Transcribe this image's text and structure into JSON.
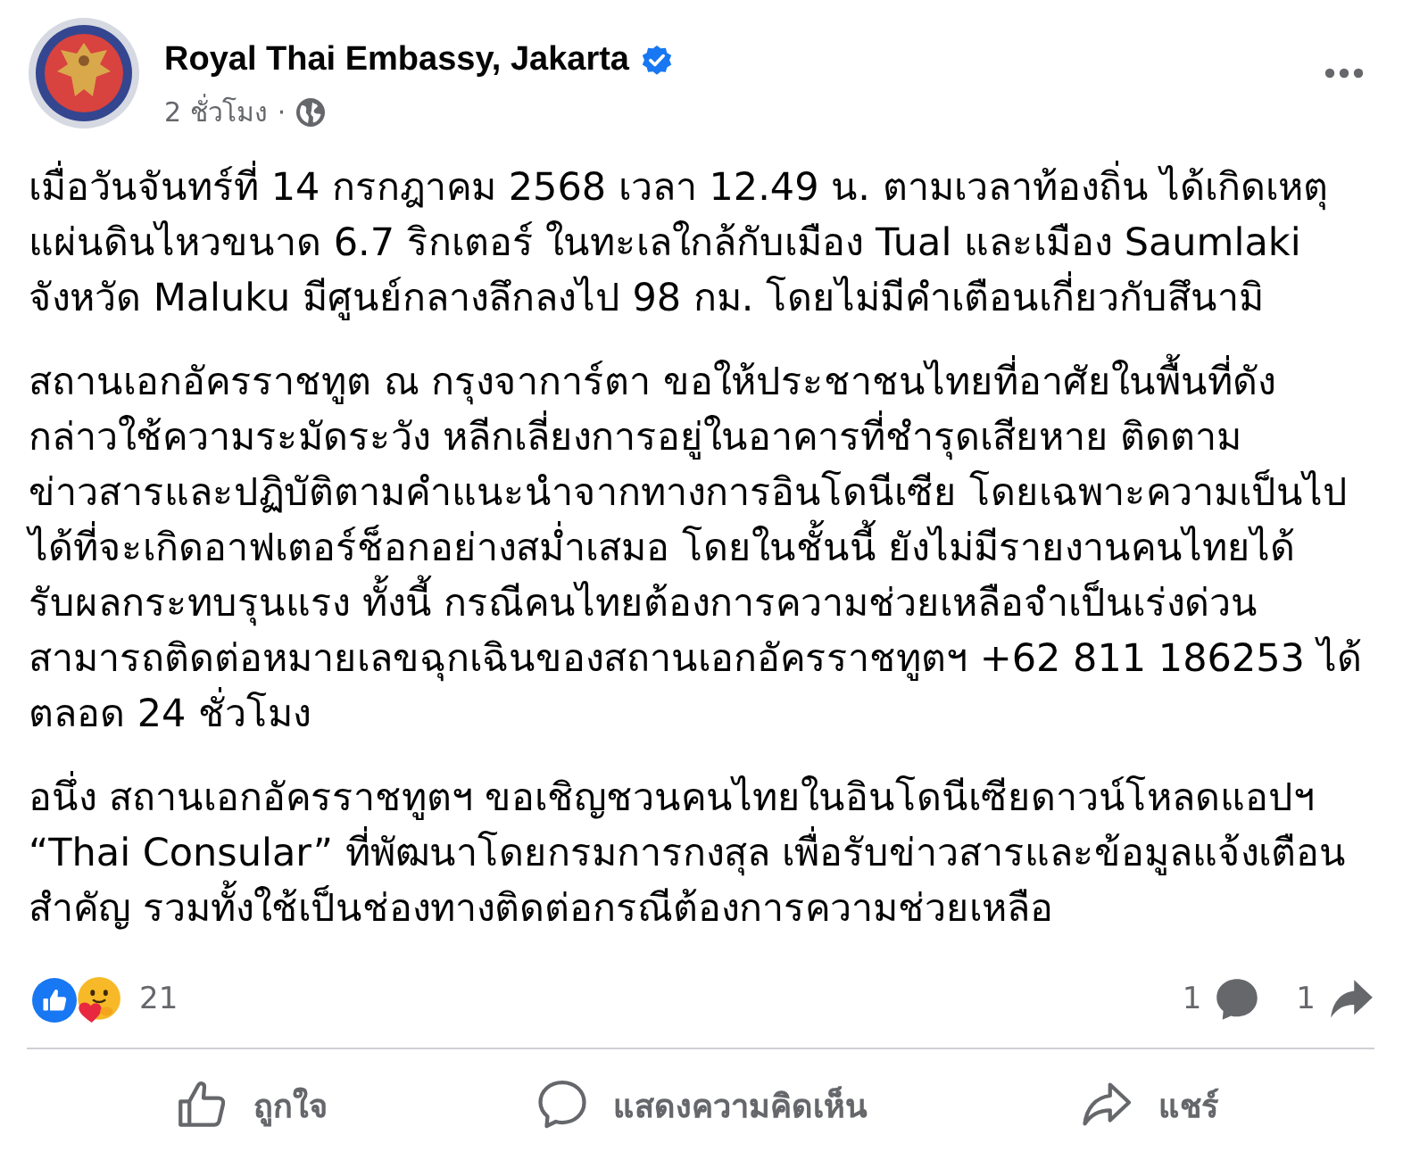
{
  "post": {
    "author": "Royal Thai Embassy, Jakarta",
    "verified": true,
    "time": "2 ชั่วโมง",
    "separator": "·"
  },
  "paragraphs": [
    {
      "lines": [
        "เมื่อวันจันทร์ที่ 14 กรกฎาคม 2568 เวลา 12.49 น. ตามเวลาท้องถิ่น ได้เกิดเหตุ",
        "แผ่นดินไหวขนาด 6.7 ริกเตอร์ ในทะเลใกล้กับเมือง Tual และเมือง Saumlaki",
        "จังหวัด Maluku มีศูนย์กลางลึกลงไป 98 กม. โดยไม่มีคำเตือนเกี่ยวกับสึนามิ"
      ]
    },
    {
      "lines": [
        "สถานเอกอัครราชทูต ณ กรุงจาการ์ตา ขอให้ประชาชนไทยที่อาศัยในพื้นที่ดัง",
        "กล่าวใช้ความระมัดระวัง หลีกเลี่ยงการอยู่ในอาคารที่ชำรุดเสียหาย ติดตาม",
        "ข่าวสารและปฏิบัติตามคำแนะนำจากทางการอินโดนีเซีย โดยเฉพาะความเป็นไป",
        "ได้ที่จะเกิดอาฟเตอร์ช็อกอย่างสม่ำเสมอ โดยในชั้นนี้ ยังไม่มีรายงานคนไทยได้",
        "รับผลกระทบรุนแรง ทั้งนี้ กรณีคนไทยต้องการความช่วยเหลือจำเป็นเร่งด่วน",
        "สามารถติดต่อหมายเลขฉุกเฉินของสถานเอกอัครราชทูตฯ +62 811 186253 ได้",
        "ตลอด 24 ชั่วโมง"
      ]
    },
    {
      "lines": [
        "อนึ่ง สถานเอกอัครราชทูตฯ ขอเชิญชวนคนไทยในอินโดนีเซียดาวน์โหลดแอปฯ",
        "“Thai Consular” ที่พัฒนาโดยกรมการกงสุล เพื่อรับข่าวสารและข้อมูลแจ้งเตือน",
        "สำคัญ รวมทั้งใช้เป็นช่องทางติดต่อกรณีต้องการความช่วยเหลือ"
      ]
    }
  ],
  "stats": {
    "reactions": "21",
    "comments": "1",
    "shares": "1"
  },
  "actions": [
    {
      "kind": "like",
      "label": "ถูกใจ"
    },
    {
      "kind": "comment",
      "label": "แสดงความคิดเห็น"
    },
    {
      "kind": "share",
      "label": "แชร์"
    }
  ]
}
